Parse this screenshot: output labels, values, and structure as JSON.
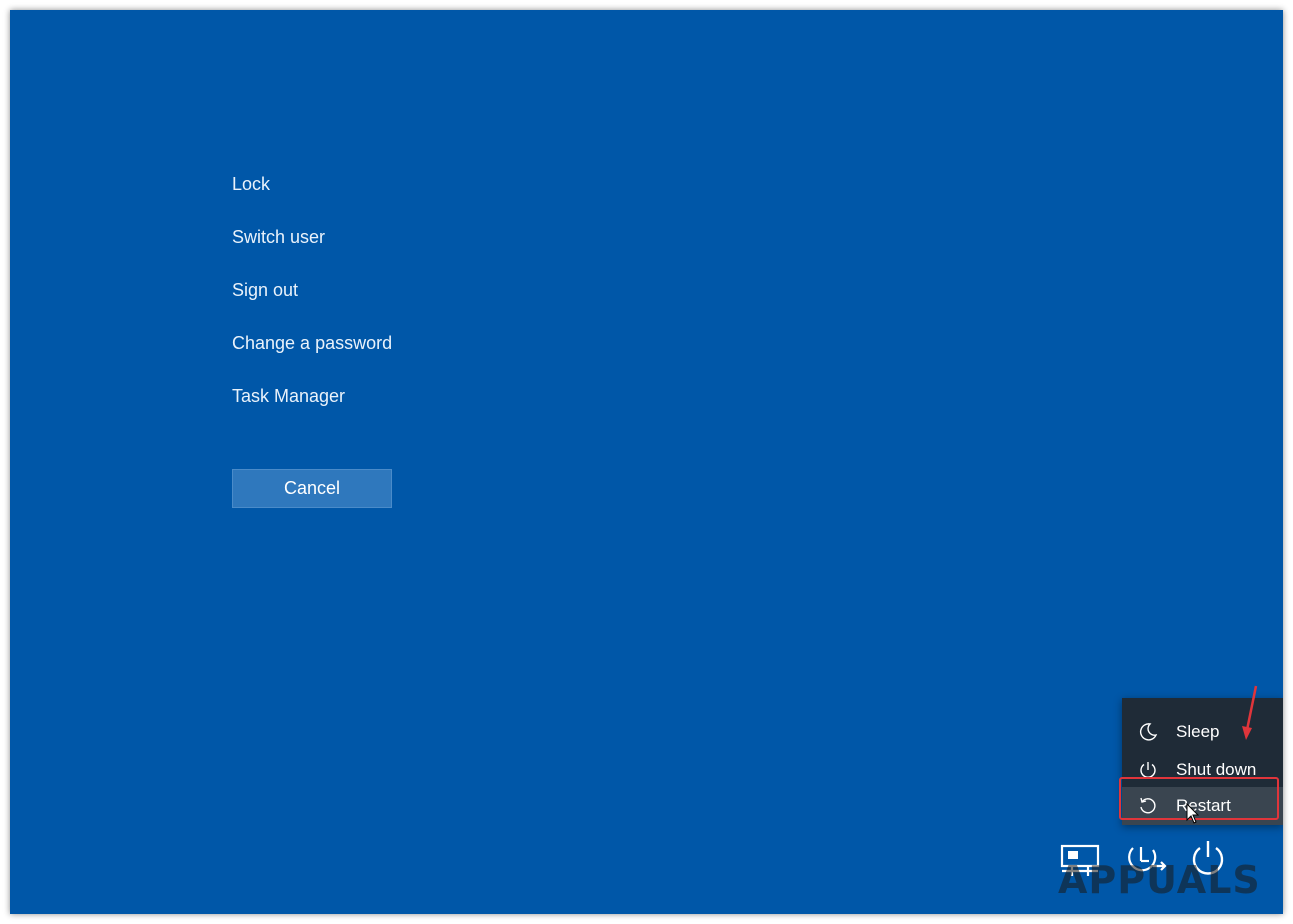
{
  "options": [
    {
      "name": "lock-option",
      "label": "Lock"
    },
    {
      "name": "switch-user-option",
      "label": "Switch user"
    },
    {
      "name": "sign-out-option",
      "label": "Sign out"
    },
    {
      "name": "change-password-option",
      "label": "Change a password"
    },
    {
      "name": "task-manager-option",
      "label": "Task Manager"
    }
  ],
  "cancel_label": "Cancel",
  "power_menu": {
    "items": [
      {
        "label": "Sleep",
        "icon": "moon-icon"
      },
      {
        "label": "Shut down",
        "icon": "power-icon"
      },
      {
        "label": "Restart",
        "icon": "restart-icon"
      }
    ],
    "highlighted": "Restart"
  },
  "tray_icons": [
    "network-icon",
    "accessibility-icon",
    "power-button-icon"
  ],
  "watermark": "APPUALS",
  "colors": {
    "background": "#0057a8",
    "menu_background": "#1f2b37",
    "highlight_border": "#e0353b",
    "annotation_arrow": "#e0353b"
  }
}
